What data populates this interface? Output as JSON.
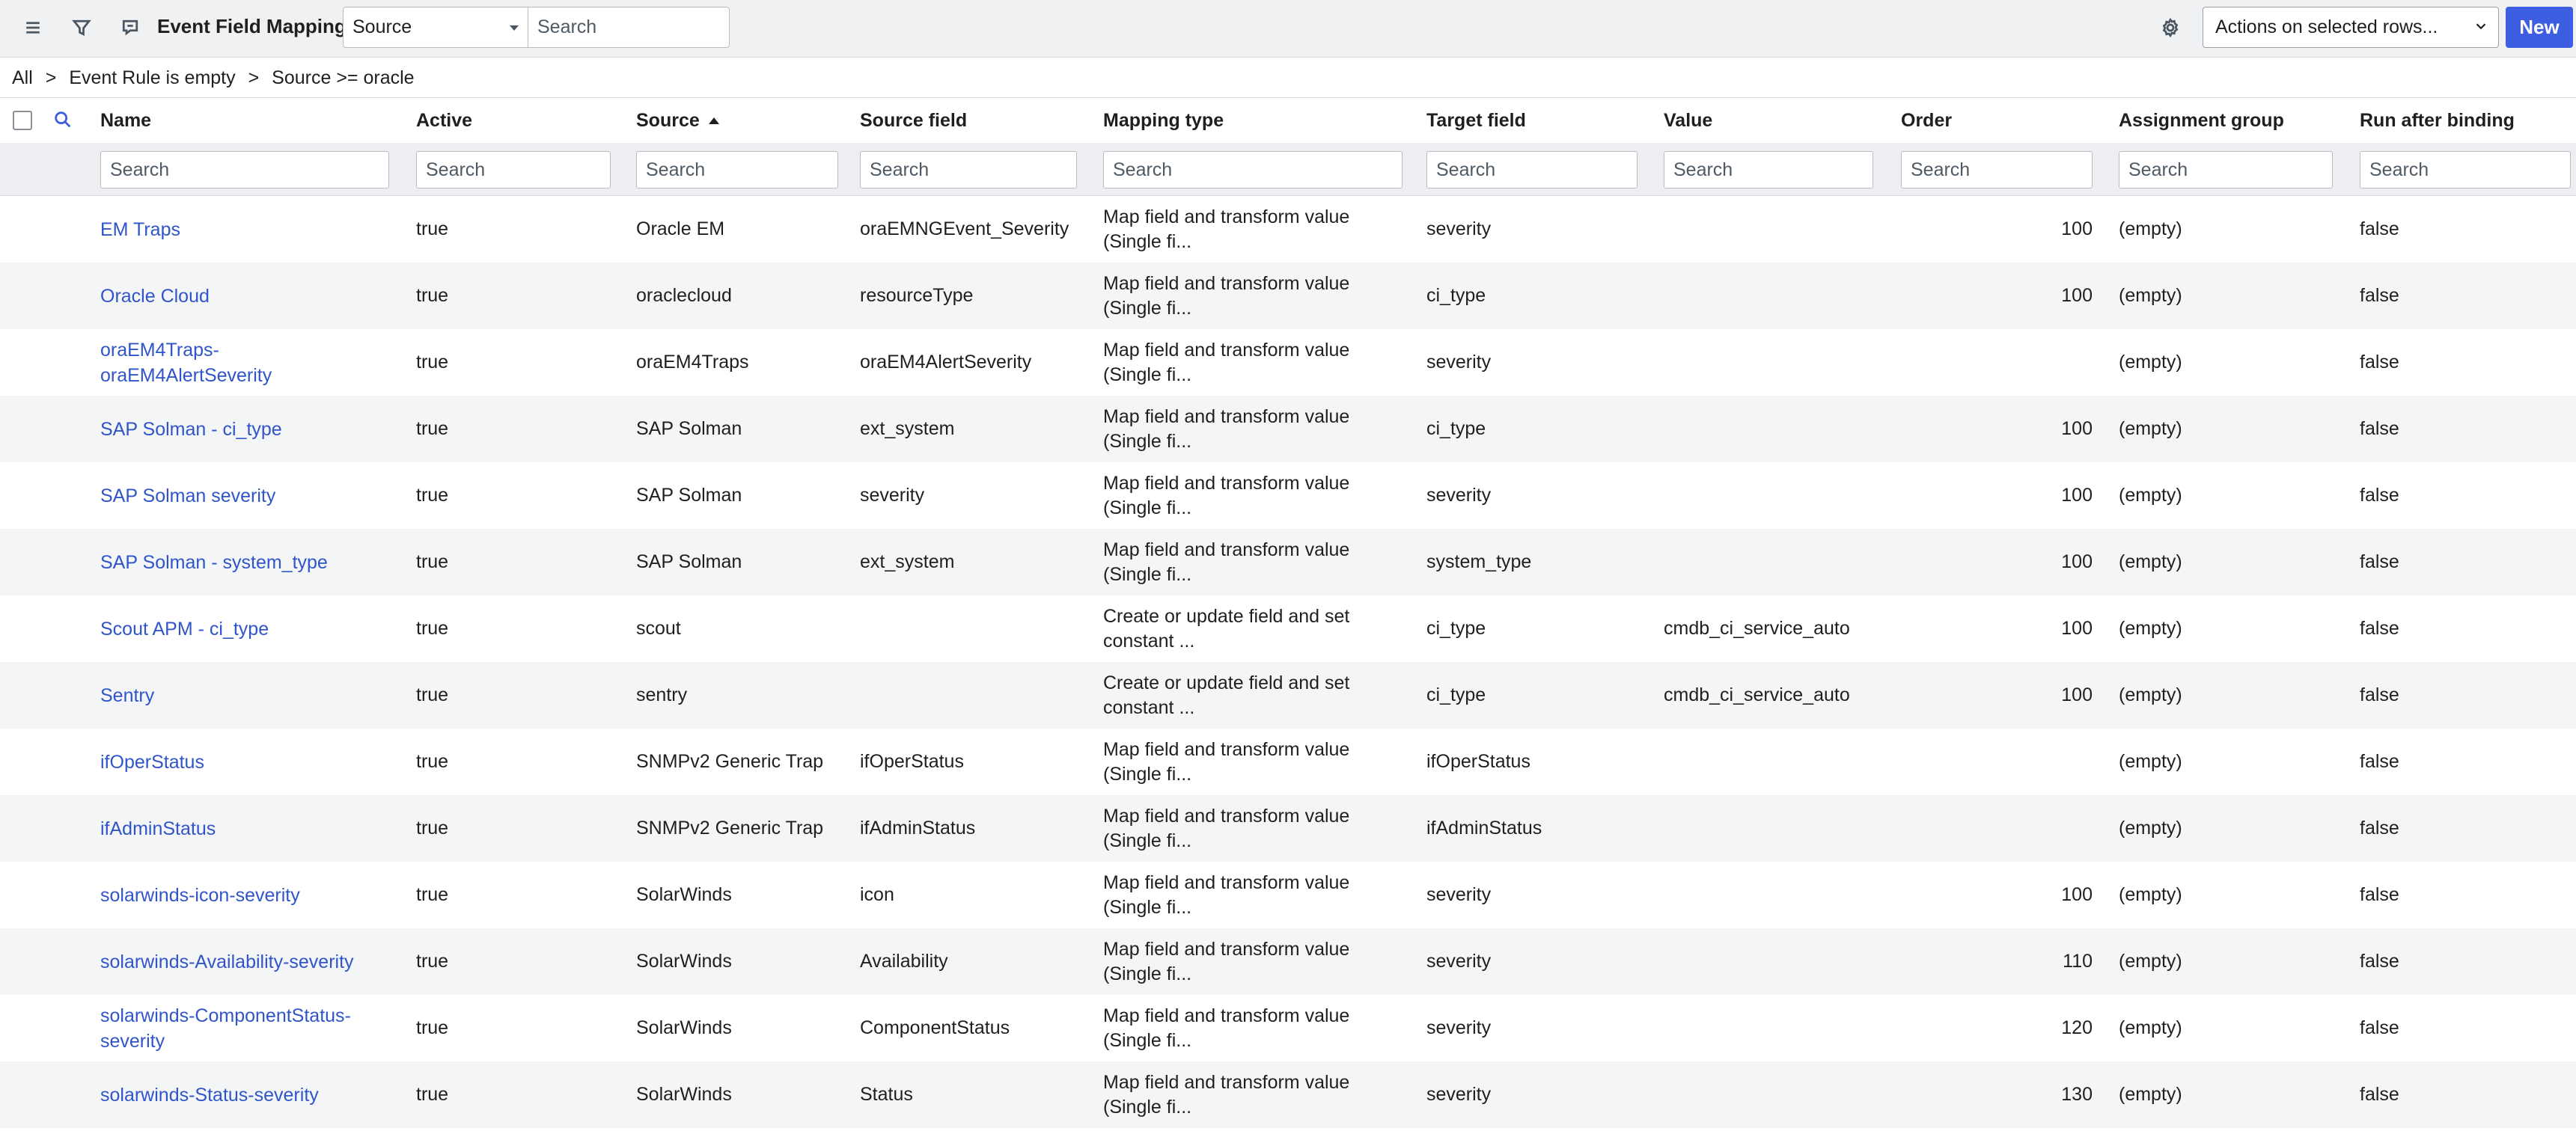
{
  "toolbar": {
    "title": "Event Field Mappings",
    "source_select": "Source",
    "search_placeholder": "Search",
    "actions_select": "Actions on selected rows...",
    "new_label": "New",
    "icons": [
      "menu-icon",
      "filter-icon",
      "chat-icon",
      "gear-icon"
    ]
  },
  "breadcrumb": {
    "items": [
      "All",
      "Event Rule is empty",
      "Source >= oracle"
    ],
    "separator": ">"
  },
  "columns": [
    {
      "key": "name",
      "label": "Name"
    },
    {
      "key": "active",
      "label": "Active"
    },
    {
      "key": "source",
      "label": "Source",
      "sorted": "ascending"
    },
    {
      "key": "source_field",
      "label": "Source field"
    },
    {
      "key": "mapping_type",
      "label": "Mapping type"
    },
    {
      "key": "target_field",
      "label": "Target field"
    },
    {
      "key": "value",
      "label": "Value"
    },
    {
      "key": "order",
      "label": "Order"
    },
    {
      "key": "assignment_group",
      "label": "Assignment group"
    },
    {
      "key": "run_after_binding",
      "label": "Run after binding"
    }
  ],
  "filter_placeholder": "Search",
  "rows": [
    {
      "name": [
        "EM Traps"
      ],
      "active": "true",
      "source": "Oracle EM",
      "source_field": "oraEMNGEvent_Severity",
      "mapping_type": [
        "Map field and transform value",
        "(Single fi..."
      ],
      "target_field": "severity",
      "value": "",
      "order": "100",
      "assignment_group": "(empty)",
      "run_after_binding": "false"
    },
    {
      "name": [
        "Oracle Cloud"
      ],
      "active": "true",
      "source": "oraclecloud",
      "source_field": "resourceType",
      "mapping_type": [
        "Map field and transform value",
        "(Single fi..."
      ],
      "target_field": "ci_type",
      "value": "",
      "order": "100",
      "assignment_group": "(empty)",
      "run_after_binding": "false"
    },
    {
      "name": [
        "oraEM4Traps-",
        "oraEM4AlertSeverity"
      ],
      "active": "true",
      "source": "oraEM4Traps",
      "source_field": "oraEM4AlertSeverity",
      "mapping_type": [
        "Map field and transform value",
        "(Single fi..."
      ],
      "target_field": "severity",
      "value": "",
      "order": "",
      "assignment_group": "(empty)",
      "run_after_binding": "false"
    },
    {
      "name": [
        "SAP Solman - ci_type"
      ],
      "active": "true",
      "source": "SAP Solman",
      "source_field": "ext_system",
      "mapping_type": [
        "Map field and transform value",
        "(Single fi..."
      ],
      "target_field": "ci_type",
      "value": "",
      "order": "100",
      "assignment_group": "(empty)",
      "run_after_binding": "false"
    },
    {
      "name": [
        "SAP Solman severity"
      ],
      "active": "true",
      "source": "SAP Solman",
      "source_field": "severity",
      "mapping_type": [
        "Map field and transform value",
        "(Single fi..."
      ],
      "target_field": "severity",
      "value": "",
      "order": "100",
      "assignment_group": "(empty)",
      "run_after_binding": "false"
    },
    {
      "name": [
        "SAP Solman - system_type"
      ],
      "active": "true",
      "source": "SAP Solman",
      "source_field": "ext_system",
      "mapping_type": [
        "Map field and transform value",
        "(Single fi..."
      ],
      "target_field": "system_type",
      "value": "",
      "order": "100",
      "assignment_group": "(empty)",
      "run_after_binding": "false"
    },
    {
      "name": [
        "Scout APM - ci_type"
      ],
      "active": "true",
      "source": "scout",
      "source_field": "",
      "mapping_type": [
        "Create or update field and set",
        "constant ..."
      ],
      "target_field": "ci_type",
      "value": "cmdb_ci_service_auto",
      "order": "100",
      "assignment_group": "(empty)",
      "run_after_binding": "false"
    },
    {
      "name": [
        "Sentry"
      ],
      "active": "true",
      "source": "sentry",
      "source_field": "",
      "mapping_type": [
        "Create or update field and set",
        "constant ..."
      ],
      "target_field": "ci_type",
      "value": "cmdb_ci_service_auto",
      "order": "100",
      "assignment_group": "(empty)",
      "run_after_binding": "false"
    },
    {
      "name": [
        "ifOperStatus"
      ],
      "active": "true",
      "source": "SNMPv2 Generic Trap",
      "source_field": "ifOperStatus",
      "mapping_type": [
        "Map field and transform value",
        "(Single fi..."
      ],
      "target_field": "ifOperStatus",
      "value": "",
      "order": "",
      "assignment_group": "(empty)",
      "run_after_binding": "false"
    },
    {
      "name": [
        "ifAdminStatus"
      ],
      "active": "true",
      "source": "SNMPv2 Generic Trap",
      "source_field": "ifAdminStatus",
      "mapping_type": [
        "Map field and transform value",
        "(Single fi..."
      ],
      "target_field": "ifAdminStatus",
      "value": "",
      "order": "",
      "assignment_group": "(empty)",
      "run_after_binding": "false"
    },
    {
      "name": [
        "solarwinds-icon-severity"
      ],
      "active": "true",
      "source": "SolarWinds",
      "source_field": "icon",
      "mapping_type": [
        "Map field and transform value",
        "(Single fi..."
      ],
      "target_field": "severity",
      "value": "",
      "order": "100",
      "assignment_group": "(empty)",
      "run_after_binding": "false"
    },
    {
      "name": [
        "solarwinds-Availability-severity"
      ],
      "active": "true",
      "source": "SolarWinds",
      "source_field": "Availability",
      "mapping_type": [
        "Map field and transform value",
        "(Single fi..."
      ],
      "target_field": "severity",
      "value": "",
      "order": "110",
      "assignment_group": "(empty)",
      "run_after_binding": "false"
    },
    {
      "name": [
        "solarwinds-ComponentStatus-",
        "severity"
      ],
      "active": "true",
      "source": "SolarWinds",
      "source_field": "ComponentStatus",
      "mapping_type": [
        "Map field and transform value",
        "(Single fi..."
      ],
      "target_field": "severity",
      "value": "",
      "order": "120",
      "assignment_group": "(empty)",
      "run_after_binding": "false"
    },
    {
      "name": [
        "solarwinds-Status-severity"
      ],
      "active": "true",
      "source": "SolarWinds",
      "source_field": "Status",
      "mapping_type": [
        "Map field and transform value",
        "(Single fi..."
      ],
      "target_field": "severity",
      "value": "",
      "order": "130",
      "assignment_group": "(empty)",
      "run_after_binding": "false"
    }
  ]
}
